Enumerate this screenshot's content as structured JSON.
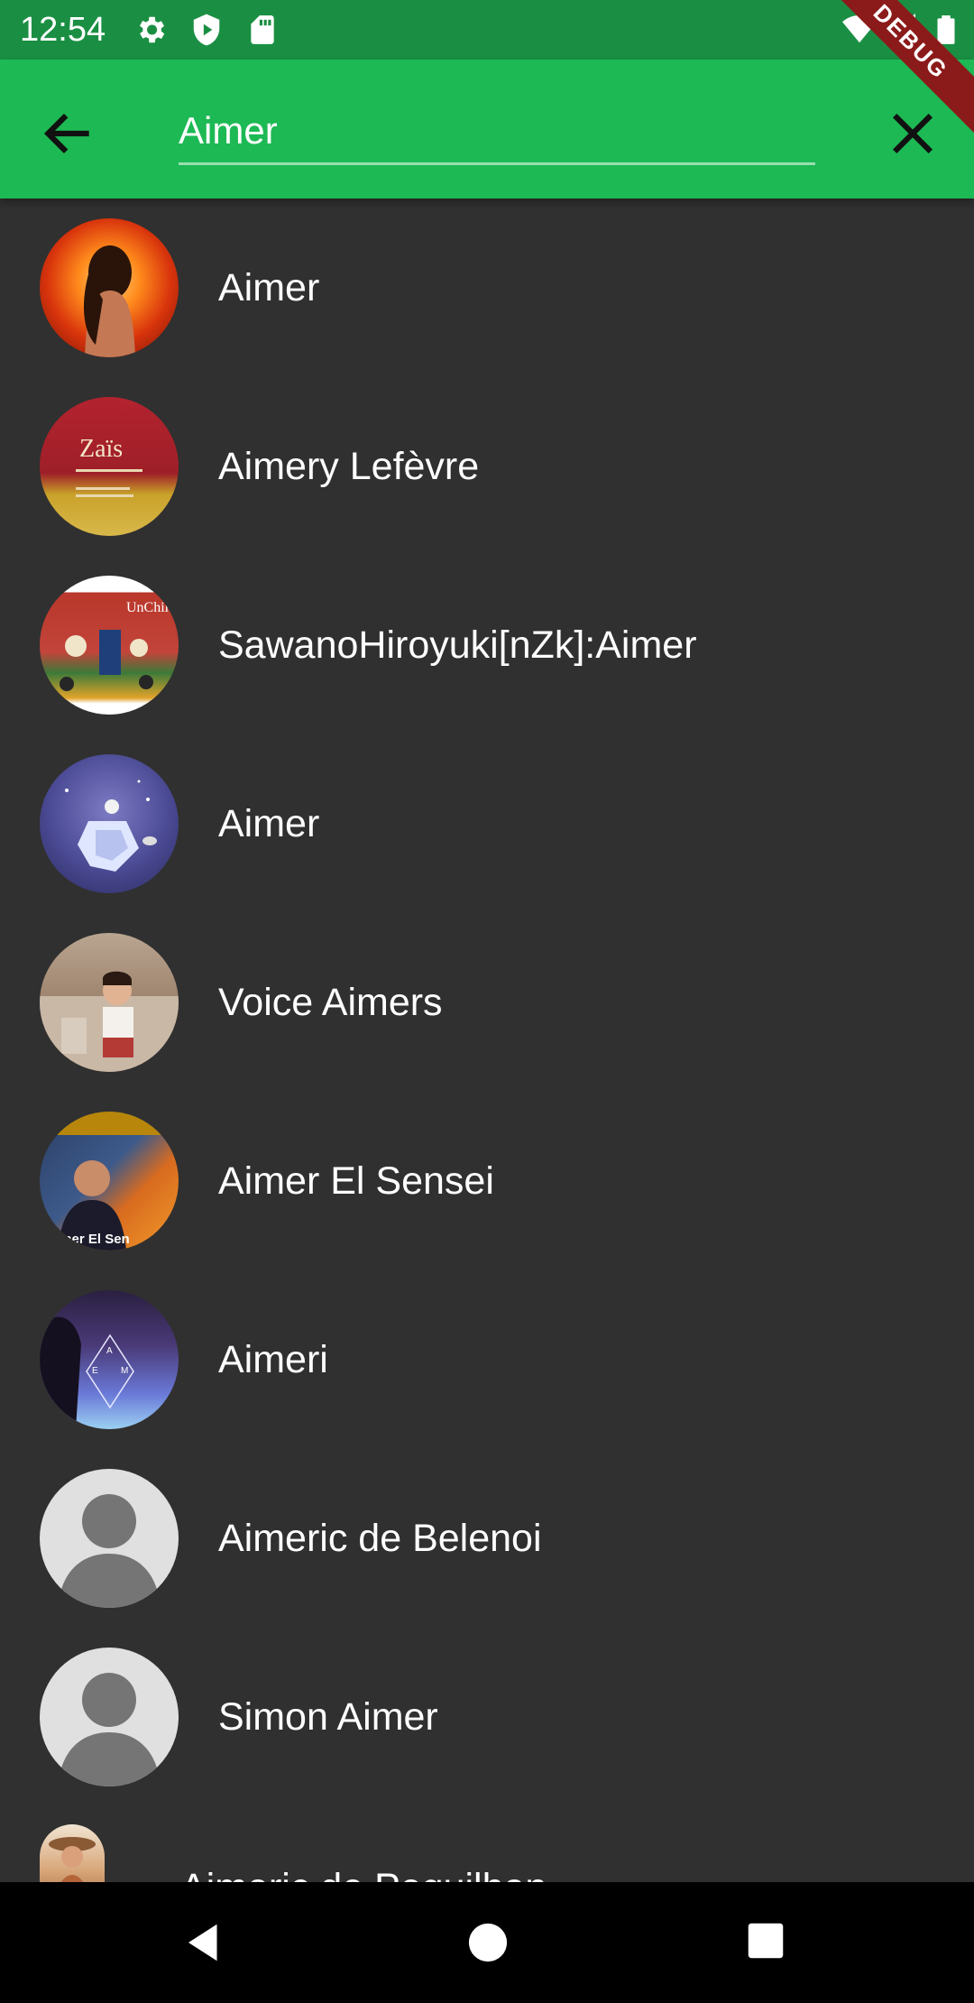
{
  "status_bar": {
    "time": "12:54",
    "icons": [
      "settings-gear-icon",
      "shield-play-icon",
      "sd-card-icon",
      "wifi-icon",
      "cell-signal-icon",
      "battery-icon"
    ],
    "debug_banner": "DEBUG"
  },
  "appbar": {
    "color": "#1db954",
    "search_value": "Aimer",
    "back_icon": "arrow-back-icon",
    "clear_icon": "close-icon"
  },
  "results": [
    {
      "name": "Aimer",
      "avatar": "fire-portrait"
    },
    {
      "name": "Aimery Lefèvre",
      "avatar": "album-zais"
    },
    {
      "name": "SawanoHiroyuki[nZk]:Aimer",
      "avatar": "tapestry-artwork"
    },
    {
      "name": "Aimer",
      "avatar": "space-planet"
    },
    {
      "name": "Voice Aimers",
      "avatar": "child-photo"
    },
    {
      "name": "Aimer El Sensei",
      "avatar": "performer-poster"
    },
    {
      "name": "Aimeri",
      "avatar": "purple-portrait"
    },
    {
      "name": "Aimeric de Belenoi",
      "avatar": "default-person"
    },
    {
      "name": "Simon Aimer",
      "avatar": "default-person"
    },
    {
      "name": "Aimeric de Peguilhan",
      "avatar": "painting"
    }
  ],
  "album_text": {
    "zais": "Zaïs",
    "unchild": "UnChild",
    "sensei": "imer El Sen",
    "aem": [
      "A",
      "E",
      "M"
    ]
  },
  "nav_bar": [
    "nav-back-icon",
    "nav-home-icon",
    "nav-recents-icon"
  ]
}
